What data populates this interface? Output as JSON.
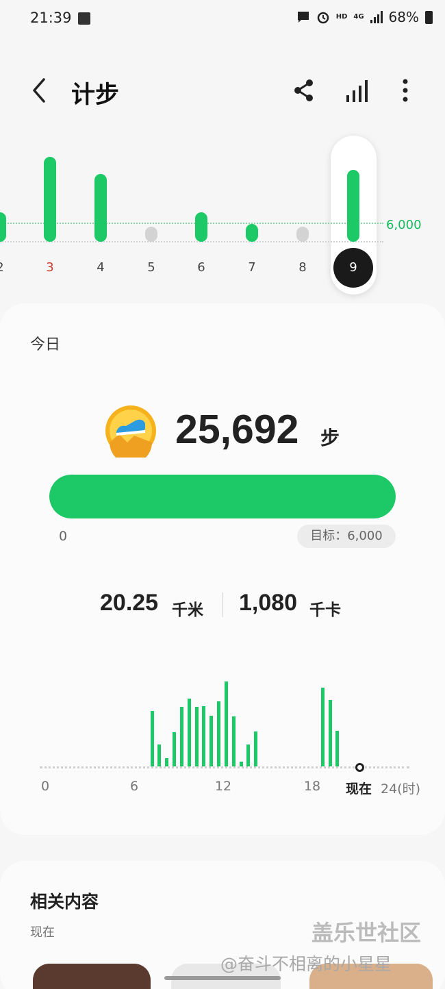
{
  "status_bar": {
    "time": "21:39",
    "network": "HD",
    "network_gen": "4G",
    "battery": "68%"
  },
  "header": {
    "title": "计步",
    "icons": [
      "back-icon",
      "share-icon",
      "bar-chart-icon",
      "more-vertical-icon"
    ]
  },
  "week": {
    "goal_label": "6,000",
    "days": [
      {
        "label": "2",
        "steps_level": 0.35,
        "style": "normal"
      },
      {
        "label": "3",
        "steps_level": 1.0,
        "style": "red"
      },
      {
        "label": "4",
        "steps_level": 0.8,
        "style": "normal"
      },
      {
        "label": "5",
        "steps_level": 0,
        "style": "normal"
      },
      {
        "label": "6",
        "steps_level": 0.35,
        "style": "normal"
      },
      {
        "label": "7",
        "steps_level": 0.15,
        "style": "normal"
      },
      {
        "label": "8",
        "steps_level": 0,
        "style": "normal"
      },
      {
        "label": "9",
        "steps_level": 0.85,
        "style": "selected"
      }
    ]
  },
  "today": {
    "label": "今日",
    "steps": "25,692",
    "steps_unit": "步",
    "progress_fraction": 1.0,
    "progress_start": "0",
    "goal": "目标：6,000",
    "distance": "20.25",
    "distance_unit": "千米",
    "calories": "1,080",
    "calories_unit": "千卡"
  },
  "hourly": {
    "ticks": [
      "0",
      "6",
      "12",
      "18"
    ],
    "now_label": "现在",
    "end_label": "24(时)",
    "bars": [
      {
        "hour": 7.2,
        "level": 0.65
      },
      {
        "hour": 7.7,
        "level": 0.26
      },
      {
        "hour": 8.2,
        "level": 0.1
      },
      {
        "hour": 8.7,
        "level": 0.4
      },
      {
        "hour": 9.2,
        "level": 0.7
      },
      {
        "hour": 9.7,
        "level": 0.8
      },
      {
        "hour": 10.2,
        "level": 0.7
      },
      {
        "hour": 10.7,
        "level": 0.71
      },
      {
        "hour": 11.2,
        "level": 0.6
      },
      {
        "hour": 11.7,
        "level": 0.77
      },
      {
        "hour": 12.2,
        "level": 1.0
      },
      {
        "hour": 12.7,
        "level": 0.59
      },
      {
        "hour": 13.2,
        "level": 0.06
      },
      {
        "hour": 13.7,
        "level": 0.26
      },
      {
        "hour": 14.2,
        "level": 0.41
      },
      {
        "hour": 18.7,
        "level": 0.93
      },
      {
        "hour": 19.2,
        "level": 0.78
      },
      {
        "hour": 19.7,
        "level": 0.42
      }
    ]
  },
  "related": {
    "title": "相关内容",
    "subtitle": "现在"
  },
  "watermark": {
    "brand": "盖乐世社区",
    "author": "@奋斗不相离的小星星"
  },
  "colors": {
    "accent": "#1dc966",
    "goal_text": "#18b85c",
    "weekend_red": "#cf3b2f"
  }
}
